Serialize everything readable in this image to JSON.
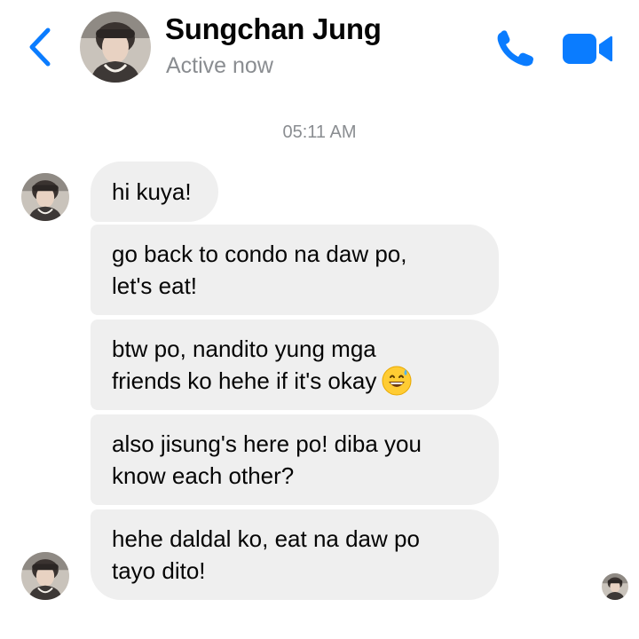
{
  "header": {
    "contact_name": "Sungchan Jung",
    "status": "Active now",
    "back_icon": "chevron-left-icon",
    "call_icon": "phone-icon",
    "video_icon": "video-camera-icon",
    "accent_color": "#0a7cff"
  },
  "conversation": {
    "timestamp": "05:11 AM",
    "messages": [
      {
        "lines": [
          "hi kuya!"
        ]
      },
      {
        "lines": [
          "go back to condo na daw po,",
          "let's eat!"
        ]
      },
      {
        "lines": [
          "btw po, nandito yung mga",
          "friends ko hehe if it's okay"
        ],
        "emoji": "grinning-sweat-emoji"
      },
      {
        "lines": [
          "also jisung's here po! diba you",
          "know each other?"
        ]
      },
      {
        "lines": [
          "hehe daldal ko, eat na daw po",
          "tayo dito!"
        ]
      }
    ],
    "bubble_color": "#efefef"
  }
}
